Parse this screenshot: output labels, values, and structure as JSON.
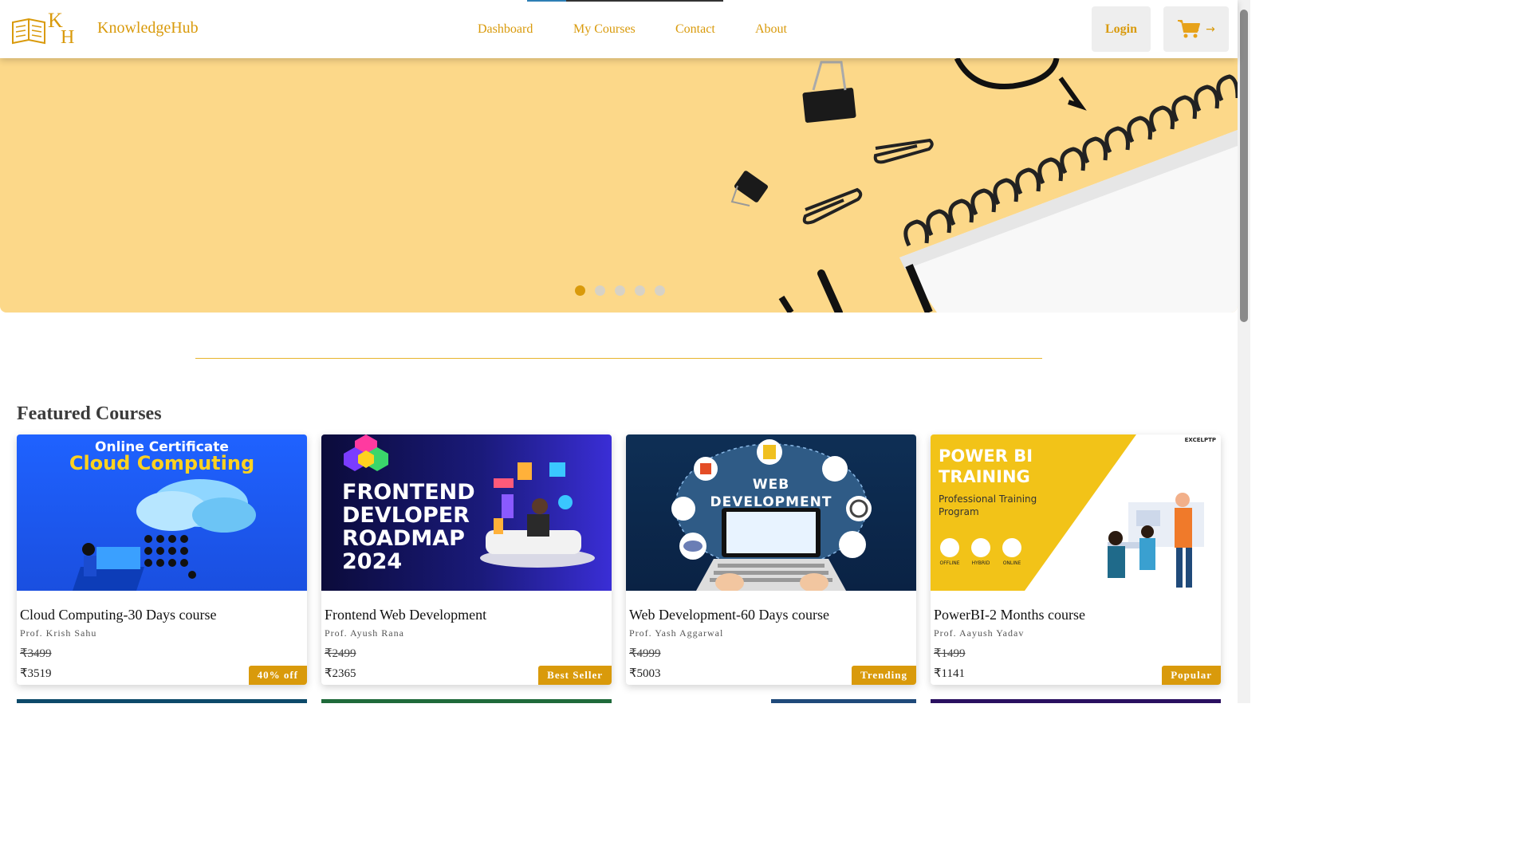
{
  "header": {
    "brand": "KnowledgeHub",
    "logo_letters": "KH",
    "nav": [
      "Dashboard",
      "My Courses",
      "Contact",
      "About"
    ],
    "login_label": "Login",
    "cart_icon": "cart-icon",
    "cart_arrow": "→"
  },
  "hero": {
    "slides": 5,
    "active_slide": 1
  },
  "featured": {
    "title": "Featured Courses",
    "courses": [
      {
        "title": "Cloud Computing-30 Days course",
        "prof": "Prof. Krish Sahu",
        "old_price": "₹3499",
        "price": "₹3519",
        "badge": "40% off",
        "image_text_1": "Online Certificate",
        "image_text_2": "Cloud Computing"
      },
      {
        "title": "Frontend Web Development",
        "prof": "Prof. Ayush Rana",
        "old_price": "₹2499",
        "price": "₹2365",
        "badge": "Best Seller",
        "image_text_1": "FRONTEND DEVLOPER ROADMAP 2024"
      },
      {
        "title": "Web Development-60 Days course",
        "prof": "Prof. Yash Aggarwal",
        "old_price": "₹4999",
        "price": "₹5003",
        "badge": "Trending",
        "image_text_1": "WEB DEVELOPMENT"
      },
      {
        "title": "PowerBI-2 Months course",
        "prof": "Prof. Aayush Yadav",
        "old_price": "₹1499",
        "price": "₹1141",
        "badge": "Popular",
        "image_text_1": "POWER BI TRAINING",
        "image_text_2": "Professional Training Program",
        "image_text_3": "EXCELPTP",
        "modes": [
          "OFFLINE",
          "HYBRID",
          "ONLINE"
        ]
      }
    ]
  },
  "colors": {
    "accent": "#d99a0b",
    "hero_bg": "#fcd889"
  }
}
